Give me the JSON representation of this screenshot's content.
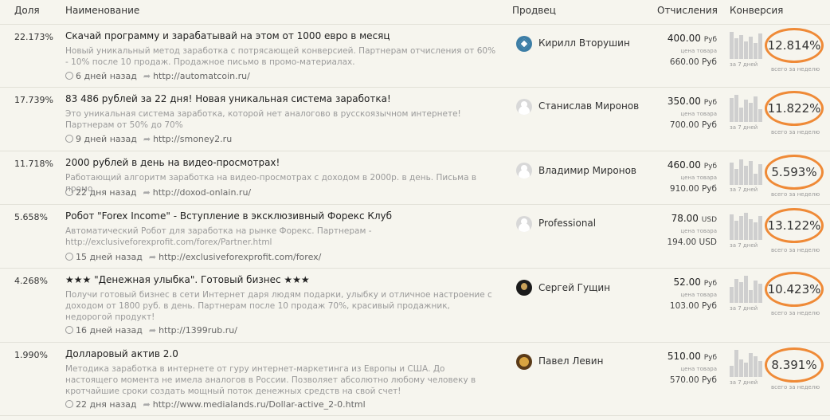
{
  "header": {
    "share": "Доля",
    "name": "Наименование",
    "seller": "Продвец",
    "commission": "Отчисления",
    "conversion": "Конверсия"
  },
  "labels": {
    "product_price": "цена товара",
    "last_7_days": "за 7 дней",
    "all_time": "всего за неделю"
  },
  "rows": [
    {
      "share": "22.173%",
      "title": "Скачай программу и зарабатывай на этом от 1000 евро в месяц",
      "desc": "Новый уникальный метод заработка с потрясающей конверсией. Партнерам отчисления от 60% - 10% после 10 продаж. Продажное письмо в промо-материалах.",
      "age": "6 дней назад",
      "url": "http://automatcoin.ru/",
      "seller": "Кирилл Вторушин",
      "commission": "400.00",
      "currency": "Руб",
      "price": "660.00 Руб",
      "conversion": "12.814%"
    },
    {
      "share": "17.739%",
      "title": "83 486 рублей за 22 дня! Новая уникальная система заработка!",
      "desc": "Это уникальная система заработка, которой нет аналогово в русскоязычном интернете! Партнерам от 50% до 70%",
      "age": "9 дней назад",
      "url": "http://smoney2.ru",
      "seller": "Станислав Миронов",
      "commission": "350.00",
      "currency": "Руб",
      "price": "700.00 Руб",
      "conversion": "11.822%"
    },
    {
      "share": "11.718%",
      "title": "2000 рублей в день на видео-просмотрах!",
      "desc": "Работающий алгоритм заработка на видео-просмотрах с доходом в 2000р. в день. Письма в промо.",
      "age": "22 дня назад",
      "url": "http://doxod-onlain.ru/",
      "seller": "Владимир Миронов",
      "commission": "460.00",
      "currency": "Руб",
      "price": "910.00 Руб",
      "conversion": "5.593%"
    },
    {
      "share": "5.658%",
      "title": "Робот \"Forex Income\" - Вступление в эксклюзивный Форекс Клуб",
      "desc": "Автоматический Робот для заработка на рынке Форекс. Партнерам - http://exclusiveforexprofit.com/forex/Partner.html",
      "age": "15 дней назад",
      "url": "http://exclusiveforexprofit.com/forex/",
      "seller": "Professional",
      "commission": "78.00",
      "currency": "USD",
      "price": "194.00 USD",
      "conversion": "13.122%"
    },
    {
      "share": "4.268%",
      "title": "★★★ \"Денежная улыбка\". Готовый бизнес ★★★",
      "desc": "Получи готовый бизнес в сети Интернет даря людям подарки, улыбку и отличное настроение с доходом от 1800 руб. в день. Партнерам после 10 продаж 70%, красивый продажник, недорогой продукт!",
      "age": "16 дней назад",
      "url": "http://1399rub.ru/",
      "seller": "Сергей Гущин",
      "commission": "52.00",
      "currency": "Руб",
      "price": "103.00 Руб",
      "conversion": "10.423%"
    },
    {
      "share": "1.990%",
      "title": "Долларовый актив 2.0",
      "desc": "Методика заработка в интернете от гуру интернет-маркетинга из Европы и США. До настоящего момента не имела аналогов в России. Позволяет абсолютно любому человеку в кротчайшие сроки создать мощный поток денежных средств на свой счет!",
      "age": "22 дня назад",
      "url": "http://www.medialands.ru/Dollar-active_2-0.html",
      "seller": "Павел Левин",
      "commission": "510.00",
      "currency": "Руб",
      "price": "570.00 Руб",
      "conversion": "8.391%"
    }
  ]
}
